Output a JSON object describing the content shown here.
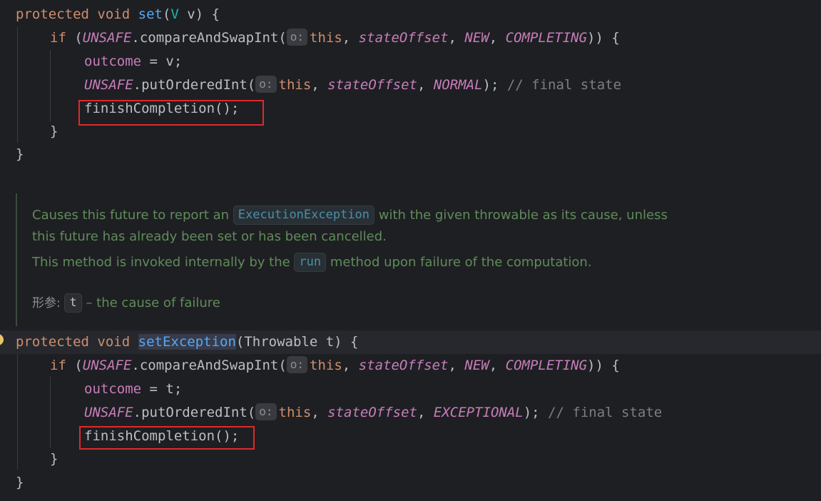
{
  "method1": {
    "sig_protected": "protected",
    "sig_void": "void",
    "sig_name": "set",
    "sig_open": "(",
    "sig_type": "V",
    "sig_param": " v) {",
    "if_kw": "if",
    "if_open": " (",
    "unsafe": "UNSAFE",
    "cas_call": ".compareAndSwapInt(",
    "hint_o": "o:",
    "this_kw": "this",
    "comma": ", ",
    "state_offset": "stateOffset",
    "new_const": "NEW",
    "completing_const": "COMPLETING",
    "cas_close": ")) {",
    "outcome_field": "outcome",
    "outcome_assign": " = v;",
    "put_ordered": ".putOrderedInt(",
    "normal_const": "NORMAL",
    "put_close": "); ",
    "final_comment": "// final state",
    "finish_call": "finishCompletion();",
    "close_if": "}",
    "close_method": "}"
  },
  "doc": {
    "line1_a": "Causes this future to report an ",
    "line1_code": "ExecutionException",
    "line1_b": " with the given throwable as its cause, unless",
    "line2": "this future has already been set or has been cancelled.",
    "line3_a": "This method is invoked internally by the ",
    "line3_code": "run",
    "line3_b": " method upon failure of the computation.",
    "param_key": "形参:",
    "param_name": "t",
    "param_desc": " – the cause of failure"
  },
  "method2": {
    "sig_protected": "protected",
    "sig_void": "void",
    "sig_name": "setException",
    "sig_rest": "(Throwable t) {",
    "if_kw": "if",
    "if_open": " (",
    "unsafe": "UNSAFE",
    "cas_call": ".compareAndSwapInt(",
    "hint_o": "o:",
    "this_kw": "this",
    "comma": ", ",
    "state_offset": "stateOffset",
    "new_const": "NEW",
    "completing_const": "COMPLETING",
    "cas_close": ")) {",
    "outcome_field": "outcome",
    "outcome_assign": " = t;",
    "put_ordered": ".putOrderedInt(",
    "exceptional_const": "EXCEPTIONAL",
    "put_close": "); ",
    "final_comment": "// final state",
    "finish_call": "finishCompletion();",
    "close_if": "}",
    "close_method": "}"
  },
  "colors": {
    "background": "#1e1f22",
    "keyword": "#cf8e6d",
    "function": "#56a8f5",
    "field": "#c77dbb",
    "comment": "#7a7e85",
    "doc_text": "#5f8c5a",
    "highlight_box": "#e0282b"
  },
  "icons": {
    "gutter": "warning-bulb-icon"
  }
}
